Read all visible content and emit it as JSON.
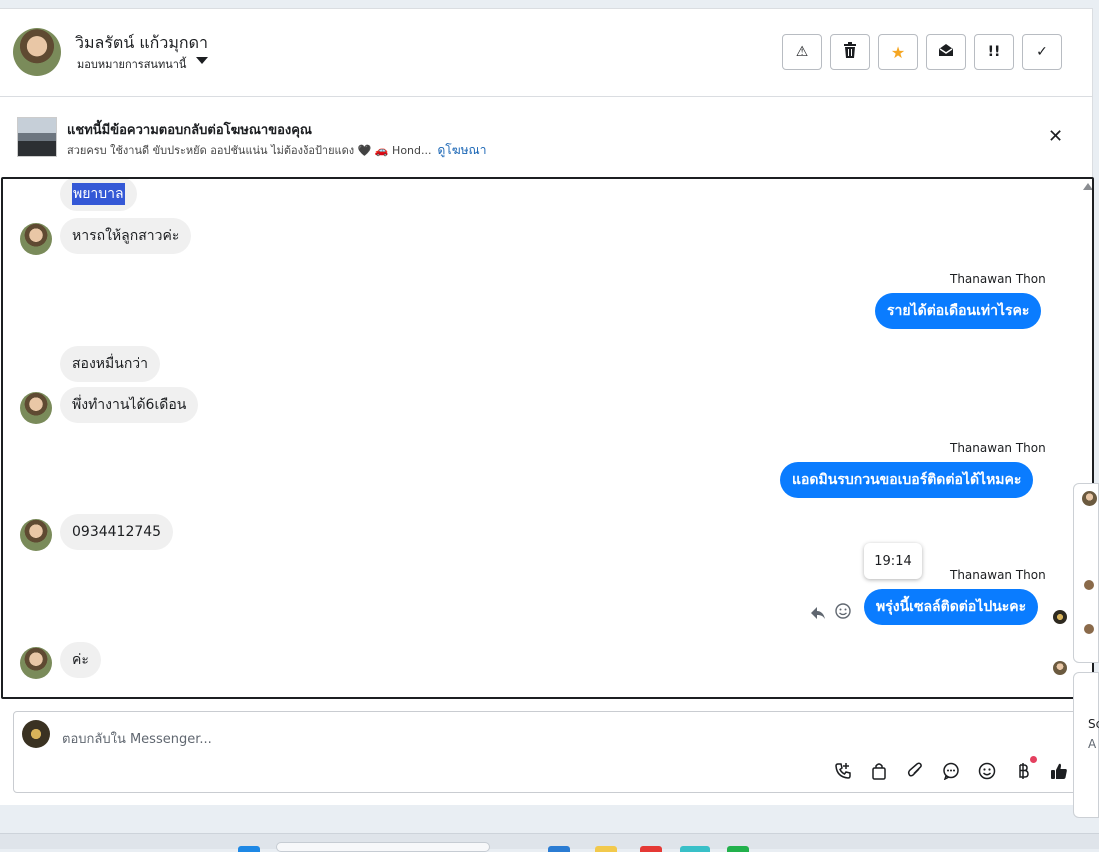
{
  "header": {
    "contact_name": "วิมลรัตน์ แก้วมุกดา",
    "assign_label": "มอบหมายการสนทนานี้",
    "toolbar": {
      "spam_icon": "⚠",
      "delete_icon": "🗑",
      "star_icon": "★",
      "mark_unread_icon": "✉",
      "follow_up_icon": "!!",
      "done_icon": "✓"
    }
  },
  "ad_banner": {
    "title": "แชทนี้มีข้อความตอบกลับต่อโฆษณาของคุณ",
    "description": "สวยครบ ใช้งานดี ขับประหยัด ออปชันแน่น ไม่ต้องง้อป้ายแดง 🖤 🚗 Hond...",
    "link": "ดูโฆษณา",
    "close": "✕"
  },
  "messages": {
    "m1": "พยาบาล",
    "m2": "หารถให้ลูกสาวค่ะ",
    "m3_sender": "Thanawan Thon",
    "m3": "รายได้ต่อเดือนเท่าไรคะ",
    "m4": "สองหมื่นกว่า",
    "m5": "พึ่งทำงานได้6เดือน",
    "m6_sender": "Thanawan Thon",
    "m6": "แอดมินรบกวนขอเบอร์ติดต่อได้ไหมคะ",
    "m7": "0934412745",
    "m8_sender": "Thanawan Thon",
    "m8": "พรุ่งนี้เซลล์ติดต่อไปนะคะ",
    "m8_time": "19:14",
    "m9": "ค่ะ"
  },
  "composer": {
    "placeholder": "ตอบกลับใน Messenger...",
    "icons": [
      "call-icon",
      "bag-icon",
      "attach-icon",
      "chat-icon",
      "emoji-icon",
      "baht-icon",
      "thumbs-up-icon"
    ]
  },
  "edge_popup": {
    "text1": "Sc",
    "text2": "A"
  },
  "colors": {
    "outgoing_bubble": "#0a7cff",
    "incoming_bubble": "#f0f0f0",
    "star": "#f5a623"
  }
}
